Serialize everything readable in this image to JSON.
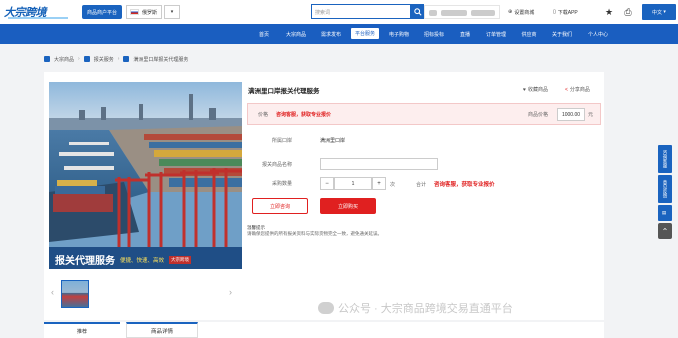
{
  "header": {
    "logo_text": "大宗跨境",
    "mall_button": "商品商户平台",
    "language": "俄罗斯",
    "search_placeholder": "搜索词",
    "settings_label": "设置商城",
    "app_label": "下载APP",
    "lang_switch": "中文"
  },
  "nav": {
    "items": [
      "首页",
      "大宗商品",
      "需求发布",
      "平台服务",
      "电子购物",
      "招标投标",
      "直播",
      "订单管理",
      "供应商",
      "关于我们",
      "个人中心"
    ],
    "active_index": 3
  },
  "breadcrumb": {
    "items": [
      "大宗商品",
      "报关服务",
      "满洲里口岸报关代理服务"
    ]
  },
  "product": {
    "title": "满洲里口岸报关代理服务",
    "favorite": "收藏商品",
    "share": "分享商品",
    "price_label": "价格",
    "price_text": "咨询客服，获取专业报价",
    "unit_price_label": "商品价格",
    "unit_price_value": "1000.00",
    "unit_price_unit": "元",
    "port_label": "所属口岸",
    "port_value": "满洲里口岸",
    "name_label": "报关商品名称",
    "qty_label": "采购数量",
    "qty_value": "1",
    "qty_unit": "次",
    "total_label": "合计",
    "total_value": "咨询客服，获取专业报价",
    "consult_button": "立即咨询",
    "buy_button": "立即购买",
    "tips_title": "温馨提示",
    "tips_body": "请确保您提供的所有报关资料与实际货物完全一致，避免通关延误。",
    "banner_main": "报关代理服务",
    "banner_sub": "便捷、快速、高效",
    "banner_logo": "大宗跨境"
  },
  "rail": {
    "items": [
      "咨询客服",
      "意见反馈",
      "返回顶部"
    ]
  },
  "tabs": {
    "left_tab": "推荐",
    "detail_tab": "商品详情"
  },
  "watermark": "公众号 · 大宗商品跨境交易直通平台",
  "colors": {
    "brand_blue": "#1a5ec0",
    "price_red": "#e02020"
  }
}
